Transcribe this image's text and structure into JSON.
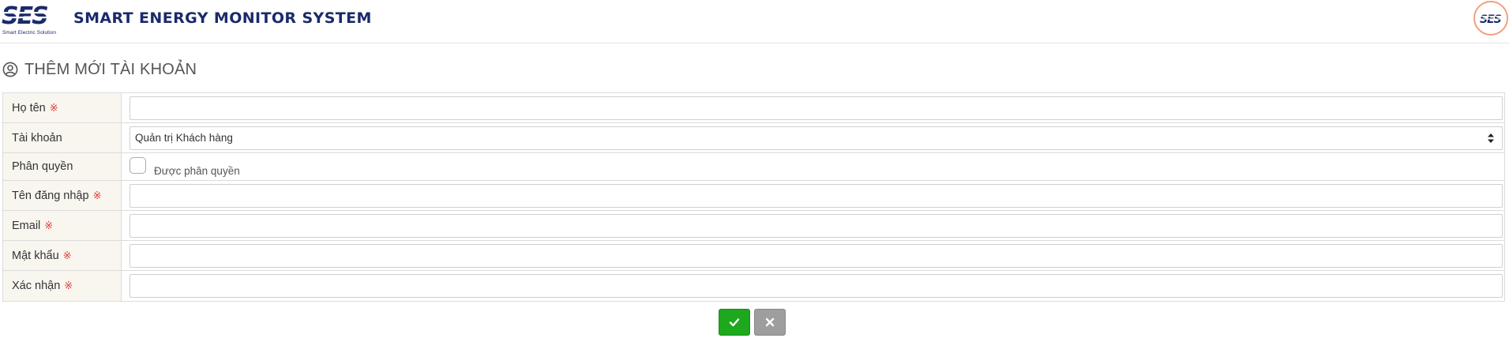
{
  "header": {
    "logo_text": "SES",
    "logo_subtitle": "Smart Electric Solution",
    "app_title": "SMART ENERGY MONITOR SYSTEM",
    "avatar_text": "SES"
  },
  "page": {
    "title": "THÊM MỚI TÀI KHOẢN",
    "title_icon": "user-circle-icon"
  },
  "form": {
    "required_mark": "※",
    "fields": [
      {
        "label": "Họ tên",
        "required": true,
        "type": "text",
        "value": ""
      },
      {
        "label": "Tài khoản",
        "required": false,
        "type": "select",
        "value": "Quản trị Khách hàng"
      },
      {
        "label": "Phân quyền",
        "required": false,
        "type": "checkbox",
        "checked": false,
        "check_label": "Được phân quyền"
      },
      {
        "label": "Tên đăng nhập",
        "required": true,
        "type": "text",
        "value": ""
      },
      {
        "label": "Email",
        "required": true,
        "type": "text",
        "value": ""
      },
      {
        "label": "Mật khẩu",
        "required": true,
        "type": "password",
        "value": ""
      },
      {
        "label": "Xác nhận",
        "required": true,
        "type": "password",
        "value": ""
      }
    ]
  },
  "actions": {
    "ok_icon": "check-icon",
    "cancel_icon": "close-icon"
  },
  "colors": {
    "brand": "#1b2a6b",
    "label_bg": "#f8f6ef",
    "required": "#e53935",
    "ok_button": "#1ea81e",
    "cancel_button": "#9e9e9e"
  }
}
